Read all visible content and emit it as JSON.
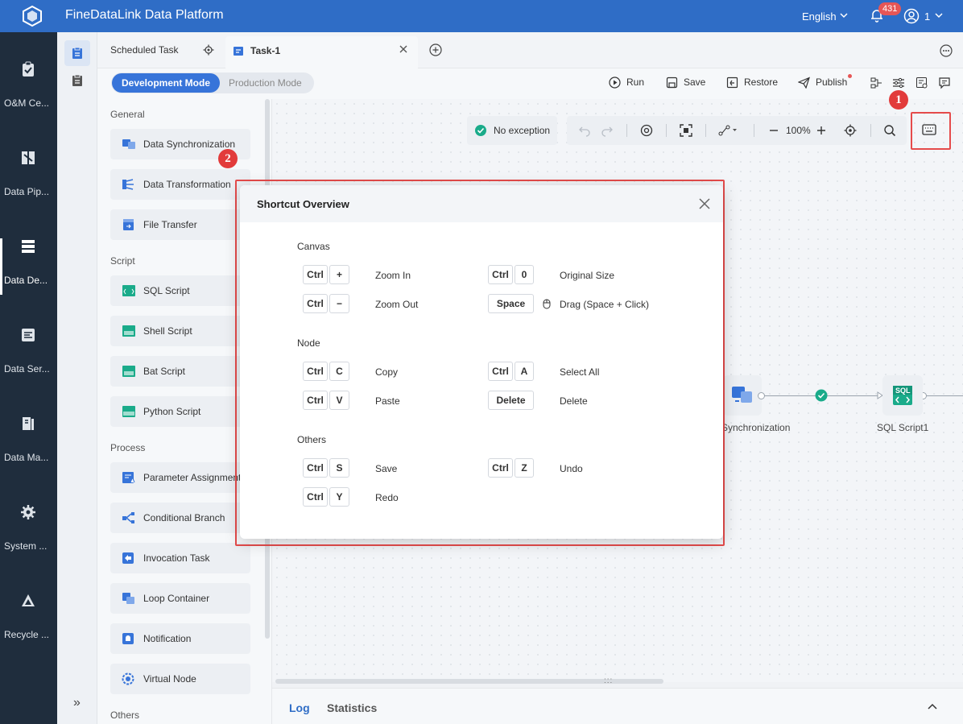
{
  "app": {
    "title": "FineDataLink Data Platform",
    "language": "English",
    "notification_count": "431",
    "user": "1"
  },
  "leftnav": {
    "items": [
      {
        "label": "O&M Ce..."
      },
      {
        "label": "Data Pip..."
      },
      {
        "label": "Data De..."
      },
      {
        "label": "Data Ser..."
      },
      {
        "label": "Data Ma..."
      },
      {
        "label": "System ..."
      },
      {
        "label": "Recycle ..."
      }
    ]
  },
  "subnav": {
    "expand": "»"
  },
  "tabs": {
    "scheduled": "Scheduled Task",
    "task": "Task-1"
  },
  "modes": {
    "dev": "Development Mode",
    "prod": "Production Mode"
  },
  "toolbar": {
    "run": "Run",
    "save": "Save",
    "restore": "Restore",
    "publish": "Publish"
  },
  "panel": {
    "general": "General",
    "script": "Script",
    "process": "Process",
    "others": "Others",
    "items": {
      "sync": "Data Synchronization",
      "transform": "Data Transformation",
      "file": "File Transfer",
      "sql": "SQL Script",
      "shell": "Shell Script",
      "bat": "Bat Script",
      "python": "Python Script",
      "param": "Parameter Assignment",
      "cond": "Conditional Branch",
      "invoke": "Invocation Task",
      "loop": "Loop Container",
      "notify": "Notification",
      "virtual": "Virtual Node"
    }
  },
  "canvas": {
    "status": "No exception",
    "zoom": "100%",
    "node1": "Synchronization",
    "node2": "SQL Script1",
    "sql_icon_text": "SQL"
  },
  "bottom": {
    "log": "Log",
    "statistics": "Statistics"
  },
  "markers": {
    "m1": "1",
    "m2": "2"
  },
  "modal": {
    "title": "Shortcut Overview",
    "canvas": {
      "title": "Canvas",
      "zoom_in": {
        "keys": [
          "Ctrl",
          "+"
        ],
        "label": "Zoom In"
      },
      "original": {
        "keys": [
          "Ctrl",
          "0"
        ],
        "label": "Original Size"
      },
      "zoom_out": {
        "keys": [
          "Ctrl",
          "−"
        ],
        "label": "Zoom Out"
      },
      "drag": {
        "keys": [
          "Space"
        ],
        "label": "Drag (Space + Click)"
      }
    },
    "node": {
      "title": "Node",
      "copy": {
        "keys": [
          "Ctrl",
          "C"
        ],
        "label": "Copy"
      },
      "select_all": {
        "keys": [
          "Ctrl",
          "A"
        ],
        "label": "Select All"
      },
      "paste": {
        "keys": [
          "Ctrl",
          "V"
        ],
        "label": "Paste"
      },
      "delete": {
        "keys": [
          "Delete"
        ],
        "label": "Delete"
      }
    },
    "others": {
      "title": "Others",
      "save": {
        "keys": [
          "Ctrl",
          "S"
        ],
        "label": "Save"
      },
      "undo": {
        "keys": [
          "Ctrl",
          "Z"
        ],
        "label": "Undo"
      },
      "redo": {
        "keys": [
          "Ctrl",
          "Y"
        ],
        "label": "Redo"
      }
    }
  },
  "colors": {
    "brand": "#2f6dc6",
    "nav": "#1f2d3d",
    "accent": "#3774d9",
    "highlight": "#e54b4b",
    "success": "#1aab8a"
  }
}
